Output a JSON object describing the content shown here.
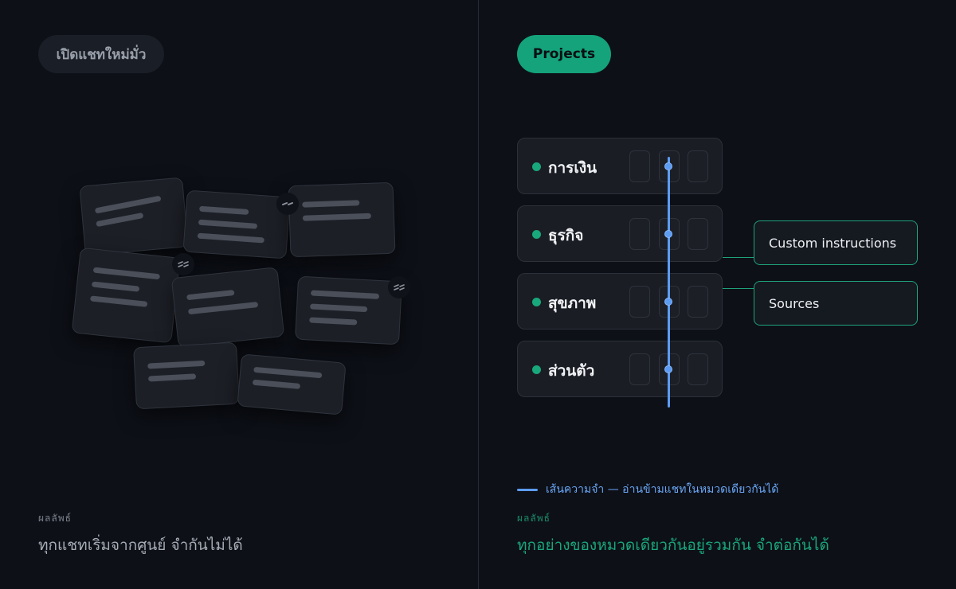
{
  "left": {
    "pill_label": "เปิดแชทใหม่มั่ว",
    "result_label": "ผลลัพธ์",
    "result_text": "ทุกแชทเริ่มจากศูนย์ จำกันไม่ได้"
  },
  "right": {
    "pill_label": "Projects",
    "projects": [
      {
        "label": "การเงิน"
      },
      {
        "label": "ธุรกิจ"
      },
      {
        "label": "สุขภาพ"
      },
      {
        "label": "ส่วนตัว"
      }
    ],
    "callouts": {
      "custom_instructions": "Custom instructions",
      "sources": "Sources"
    },
    "legend_text": "เส้นความจำ — อ่านข้ามแชทในหมวดเดียวกันได้",
    "result_label": "ผลลัพธ์",
    "result_text": "ทุกอย่างของหมวดเดียวกันอยู่รวมกัน จำต่อกันได้"
  },
  "colors": {
    "accent_green": "#14a37a",
    "memory_blue": "#5c9cf2",
    "background": "#0d1017"
  },
  "icons": {
    "link_badge": "broken-link-icon"
  }
}
